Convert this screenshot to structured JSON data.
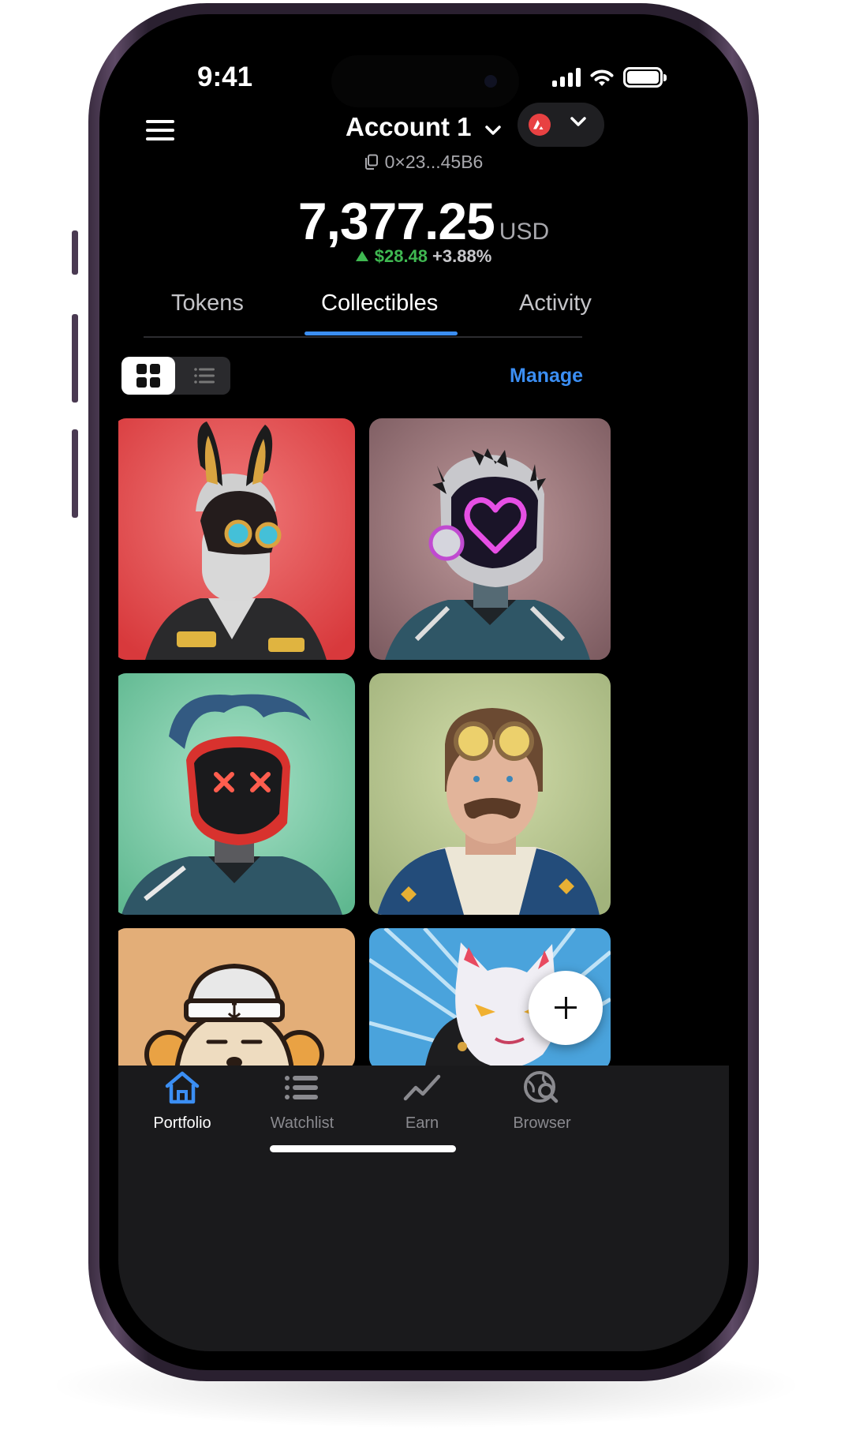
{
  "status_bar": {
    "time": "9:41",
    "signal_icon": "cellular-signal-icon",
    "wifi_icon": "wifi-icon",
    "battery_icon": "battery-icon"
  },
  "header": {
    "menu_icon": "hamburger-menu-icon",
    "account_name": "Account 1",
    "account_dropdown_icon": "chevron-down-icon",
    "address": "0×23...45B6",
    "copy_icon": "copy-icon",
    "network_icon": "avalanche-logo-icon",
    "network_dropdown_icon": "chevron-down-icon"
  },
  "balance": {
    "amount": "7,377.25",
    "currency": "USD",
    "change_amount": "$28.48",
    "change_percent": "+3.88%",
    "change_direction": "up"
  },
  "tabs": [
    {
      "label": "Tokens",
      "active": false
    },
    {
      "label": "Collectibles",
      "active": true
    },
    {
      "label": "Activity",
      "active": false
    }
  ],
  "collectibles": {
    "view_mode": "grid",
    "grid_view_icon": "grid-view-icon",
    "list_view_icon": "list-view-icon",
    "manage_label": "Manage",
    "items": [
      {
        "name": "nft-bunny-mask",
        "background": "#e04a4a"
      },
      {
        "name": "nft-heart-visor-helmet",
        "background": "#8e6b6e"
      },
      {
        "name": "nft-x-eyes-mask",
        "background": "#7cc7a8"
      },
      {
        "name": "nft-aviator-goggles",
        "background": "#b5c48d"
      },
      {
        "name": "nft-sailor-monkey",
        "background": "#e3ae78"
      },
      {
        "name": "nft-fox-mask",
        "background": "#4aa3dc"
      }
    ]
  },
  "fab_icon": "plus-icon",
  "colors": {
    "accent": "#3b8ef3",
    "positive": "#3fb851",
    "background": "#000000",
    "nav_background": "#1a1a1c"
  },
  "bottom_nav": [
    {
      "label": "Portfolio",
      "icon": "home-icon",
      "active": true
    },
    {
      "label": "Watchlist",
      "icon": "list-icon",
      "active": false
    },
    {
      "label": "Earn",
      "icon": "chart-trend-icon",
      "active": false
    },
    {
      "label": "Browser",
      "icon": "globe-search-icon",
      "active": false
    }
  ]
}
